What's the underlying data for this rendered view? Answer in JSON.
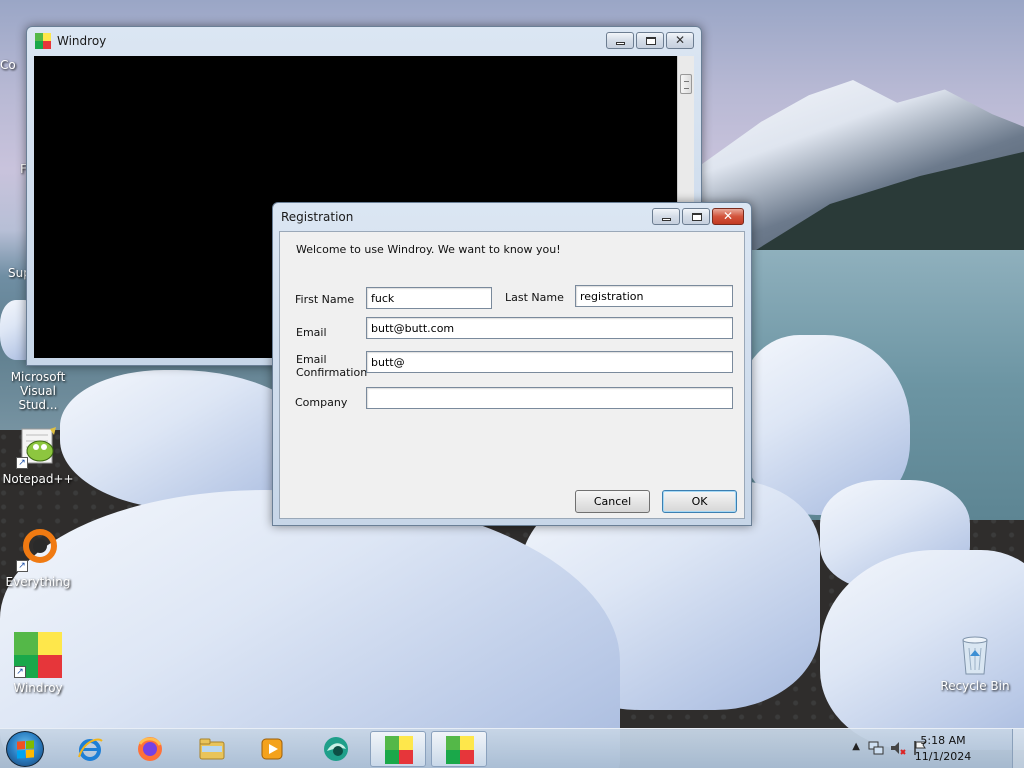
{
  "desktop": {
    "icons": [
      {
        "key": "notepadpp",
        "label": "Notepad++"
      },
      {
        "key": "everything",
        "label": "Everything"
      },
      {
        "key": "windroy",
        "label": "Windroy"
      },
      {
        "key": "recycle",
        "label": "Recycle Bin"
      },
      {
        "key": "vs",
        "label": "Microsoft Visual Stud..."
      }
    ],
    "partial_labels": [
      "Co",
      "F",
      "Sup"
    ]
  },
  "windroy_window": {
    "title": "Windroy"
  },
  "registration_dialog": {
    "title": "Registration",
    "welcome_text": "Welcome to use Windroy. We want to know you!",
    "first_name_label": "First Name",
    "first_name_value": "fuck",
    "last_name_label": "Last Name",
    "last_name_value": "registration",
    "email_label": "Email",
    "email_value": "butt@butt.com",
    "email_confirmation_label_line1": "Email",
    "email_confirmation_label_line2": "Confirmation",
    "email_confirmation_value": "butt@",
    "company_label": "Company",
    "company_value": "",
    "cancel_label": "Cancel",
    "ok_label": "OK"
  },
  "taskbar": {
    "pinned": [
      "start-button",
      "internet-explorer",
      "firefox",
      "file-explorer",
      "media-player",
      "app-icon-teal",
      "windroy",
      "windroy"
    ],
    "clock_time": "5:18 AM",
    "clock_date": "11/1/2024"
  },
  "colors": {
    "taskbar": "#aabed4",
    "window_chrome": "#c7d6e8",
    "dialog_body": "#f0f0f0",
    "close_button": "#c23a22"
  }
}
